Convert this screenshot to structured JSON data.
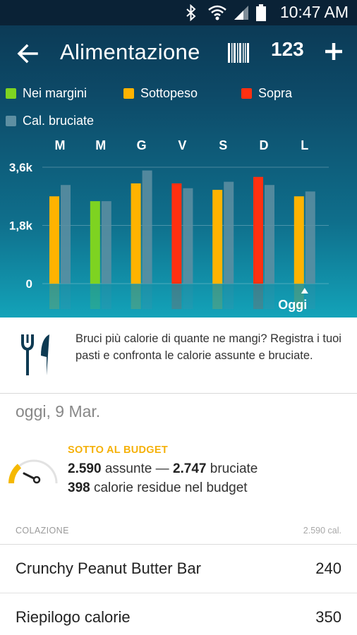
{
  "status_bar": {
    "time": "10:47 AM",
    "icons": [
      "bluetooth-icon",
      "wifi-icon",
      "signal-icon",
      "battery-icon"
    ]
  },
  "app_bar": {
    "title": "Alimentazione",
    "icons": [
      "back-arrow-icon",
      "barcode-icon",
      "quick-calories-icon",
      "plus-icon"
    ],
    "quick_calories_label": "123"
  },
  "legend": [
    {
      "label": "Nei margini",
      "color": "#7ed321"
    },
    {
      "label": "Sottopeso",
      "color": "#ffb300"
    },
    {
      "label": "Sopra",
      "color": "#ff3010"
    },
    {
      "label": "Cal. bruciate",
      "color": "#5e8fa2"
    }
  ],
  "chart_data": {
    "type": "bar",
    "categories": [
      "M",
      "M",
      "G",
      "V",
      "S",
      "D",
      "L"
    ],
    "series": [
      {
        "name": "assunte",
        "values": [
          2.7,
          2.55,
          3.1,
          3.1,
          2.9,
          3.3,
          2.7
        ],
        "status": [
          "Sottopeso",
          "Nei margini",
          "Sottopeso",
          "Sopra",
          "Sottopeso",
          "Sopra",
          "Sottopeso"
        ]
      },
      {
        "name": "Cal. bruciate",
        "values": [
          3.05,
          2.55,
          3.5,
          2.95,
          3.15,
          3.05,
          2.85
        ]
      }
    ],
    "y_ticks": [
      "3,6k",
      "1,8k",
      "0"
    ],
    "ylim": [
      0,
      3.6
    ],
    "today_label": "Oggi",
    "today_index": 6,
    "grid": true
  },
  "info_card": {
    "text": "Bruci più calorie di quante ne mangi? Registra i tuoi pasti e confronta le calorie assunte e bruciate."
  },
  "summary": {
    "date": "oggi, 9 Mar.",
    "status": "SOTTO AL BUDGET",
    "consumed": "2.590",
    "consumed_label": "assunte",
    "separator": "—",
    "burned": "2.747",
    "burned_label": "bruciate",
    "remaining": "398",
    "remaining_label": "calorie residue nel budget",
    "gauge_fraction": 0.62
  },
  "meal_section": {
    "name": "COLAZIONE",
    "total": "2.590 cal."
  },
  "food_items": [
    {
      "name": "Crunchy Peanut Butter Bar",
      "calories": "240"
    },
    {
      "name": "Riepilogo calorie",
      "calories": "350"
    }
  ]
}
